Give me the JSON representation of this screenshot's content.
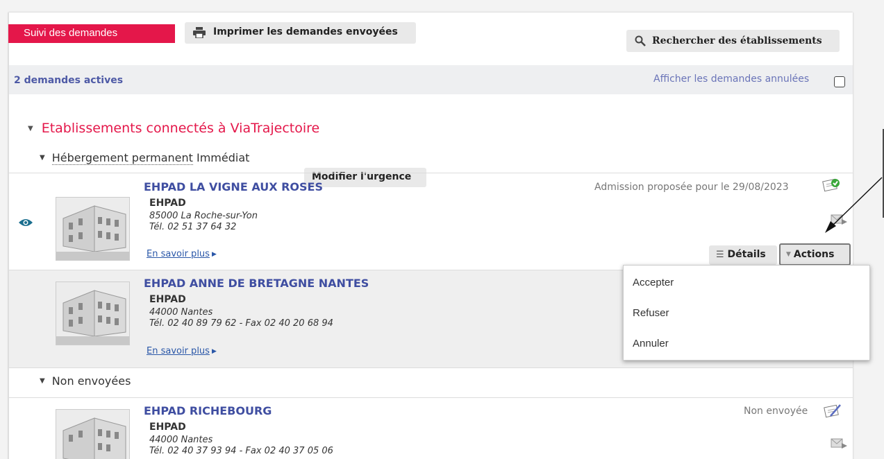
{
  "toolbar": {
    "tracking_label": "Suivi des demandes",
    "print_label": "Imprimer les demandes envoyées",
    "search_label": "Rechercher des établissements"
  },
  "summary": {
    "active_count": "2 demandes actives",
    "show_cancelled_label": "Afficher les demandes annulées",
    "show_cancelled_checked": false
  },
  "section": {
    "title": "Etablissements connectés à ViaTrajectoire"
  },
  "group": {
    "title_main": "Hébergement permanent",
    "title_urgency": "Immédiat",
    "urgency_button": "Modifier l'urgence"
  },
  "establishments": [
    {
      "name": "EHPAD LA VIGNE AUX ROSES",
      "type": "EHPAD",
      "city": "85000 La Roche-sur-Yon",
      "phone": "Tél. 02 51 37 64 32",
      "more": "En savoir plus",
      "status": "Admission proposée pour le 29/08/2023",
      "status_icon": "admission-proposed-icon"
    },
    {
      "name": "EHPAD ANNE DE BRETAGNE NANTES",
      "type": "EHPAD",
      "city": "44000 Nantes",
      "phone": "Tél. 02 40 89 79 62 - Fax 02 40 20 68 94",
      "more": "En savoir plus"
    }
  ],
  "row_buttons": {
    "details": "Détails",
    "actions": "Actions"
  },
  "actions_menu": [
    "Accepter",
    "Refuser",
    "Annuler"
  ],
  "unsent_group": {
    "title": "Non envoyées",
    "establishment": {
      "name": "EHPAD RICHEBOURG",
      "type": "EHPAD",
      "city": "44000 Nantes",
      "phone": "Tél. 02 40 37 93 94 - Fax 02 40 37 05 06",
      "status": "Non envoyée",
      "status_icon": "not-sent-icon"
    }
  },
  "colors": {
    "brand": "#e4174a",
    "link": "#3f4ea1",
    "bar": "#eeeff1"
  }
}
